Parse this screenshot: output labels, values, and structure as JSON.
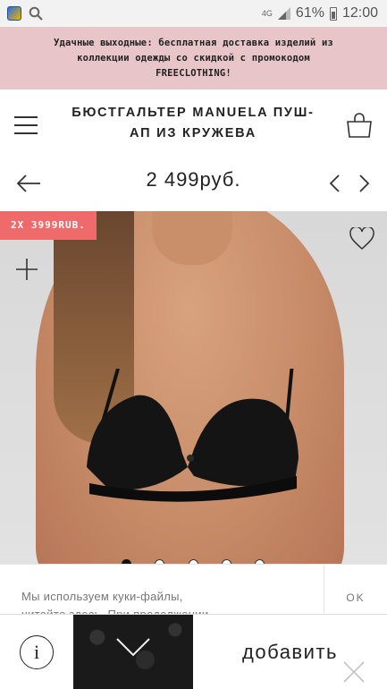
{
  "status_bar": {
    "network": "4G",
    "battery_percent": "61%",
    "time": "12:00"
  },
  "promo": {
    "line1": "Удачные выходные: бесплатная доставка изделий из",
    "line2": "коллекции одежды со скидкой с промокодом",
    "line3": "FREECLOTHING!"
  },
  "header": {
    "title_line1": "БЮСТГАЛЬТЕР MANUELA ПУШ-",
    "title_line2": "АП ИЗ КРУЖЕВА"
  },
  "product": {
    "price": "2 499руб.",
    "promo_badge": "2X 3999RUB.",
    "gallery_dots": 5,
    "active_dot": 0
  },
  "cookie": {
    "line1": "Мы используем куки-файлы,",
    "line2": "читайте здесь. При продолжении",
    "ok_label": "OK"
  },
  "bottom": {
    "info_label": "i",
    "add_label": "добавить"
  },
  "colors": {
    "promo_bg": "#e8c5c9",
    "badge_bg": "#ef6b6b"
  }
}
